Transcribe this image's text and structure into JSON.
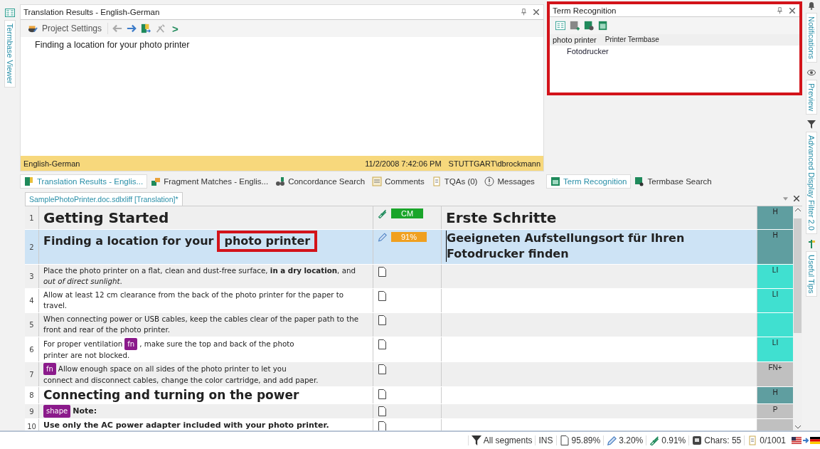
{
  "left_strip": {
    "tab": "Termbase Viewer"
  },
  "results_panel": {
    "title": "Translation Results - English-German",
    "toolbar": {
      "project_settings": "Project Settings",
      "next_symbol": ">"
    },
    "result": "Finding a location for your photo printer",
    "info_bar": {
      "language_pair": "English-German",
      "date": "11/2/2008 7:42:06 PM",
      "user": "STUTTGART\\dbrockmann"
    }
  },
  "term_panel": {
    "title": "Term Recognition",
    "highlighted": true,
    "terms": [
      {
        "source": "photo printer",
        "termbase": "Printer Termbase",
        "target": "Fotodrucker"
      }
    ]
  },
  "bottom_tabs": [
    {
      "label": "Translation Results - Englis...",
      "selected": true,
      "kind": "results"
    },
    {
      "label": "Fragment Matches - Englis...",
      "selected": false,
      "kind": "fragment"
    },
    {
      "label": "Concordance Search",
      "selected": false,
      "kind": "concordance"
    },
    {
      "label": "Comments",
      "selected": false,
      "kind": "comments"
    },
    {
      "label": "TQAs (0)",
      "selected": false,
      "kind": "tqa"
    },
    {
      "label": "Messages",
      "selected": false,
      "kind": "messages"
    }
  ],
  "term_tabs": [
    {
      "label": "Term Recognition",
      "selected": true,
      "kind": "term"
    },
    {
      "label": "Termbase Search",
      "selected": false,
      "kind": "search"
    }
  ],
  "document_tab": {
    "label": "SamplePhotoPrinter.doc.sdlxliff [Translation]*"
  },
  "segments": [
    {
      "number": "1",
      "kind": "heading1",
      "source": [
        {
          "kind": "text",
          "text": "Getting Started"
        }
      ],
      "status": {
        "kind": "confirmed",
        "match": "CM"
      },
      "target": "Erste Schritte",
      "selected": false,
      "structure": {
        "label": "H",
        "color": "#5f9ea0"
      }
    },
    {
      "number": "2",
      "kind": "heading2",
      "source": [
        {
          "kind": "text",
          "text": "Finding a location for your"
        },
        {
          "kind": "term",
          "text": "photo printer",
          "highlighted": true
        }
      ],
      "status": {
        "kind": "draft",
        "match": "91%"
      },
      "target": "Geeigneten Aufstellungsort für Ihren Fotodrucker finden",
      "selected": true,
      "structure": {
        "label": "H",
        "color": "#5f9ea0"
      }
    },
    {
      "number": "3",
      "kind": "body",
      "source": [
        {
          "kind": "text",
          "text": "Place the photo printer on a flat, clean and dust-free surface, **in a dry location**, and *out of direct sunlight*."
        }
      ],
      "status": {
        "kind": "untranslated"
      },
      "selected": false,
      "structure": {
        "label": "LI",
        "color": "#40e0d0"
      }
    },
    {
      "number": "4",
      "kind": "body",
      "source": [
        {
          "kind": "text",
          "text": "Allow at least 12 cm clearance from the back of the photo printer for the paper to travel."
        }
      ],
      "status": {
        "kind": "untranslated"
      },
      "selected": false,
      "structure": {
        "label": "LI",
        "color": "#40e0d0"
      }
    },
    {
      "number": "5",
      "kind": "body",
      "source": [
        {
          "kind": "text",
          "text": "When connecting power or USB cables, keep the cables clear of the paper path to the front and rear of the photo printer."
        }
      ],
      "status": {
        "kind": "untranslated"
      },
      "selected": false,
      "structure": {
        "color": "#40e0d0"
      }
    },
    {
      "number": "6",
      "kind": "body",
      "source": [
        {
          "kind": "text",
          "text": "For proper ventilation"
        },
        {
          "kind": "tag",
          "text": "fn"
        },
        {
          "kind": "text",
          "text": ", make sure the top and back of the photo"
        },
        {
          "kind": "text",
          "text": "printer are not blocked."
        }
      ],
      "status": {
        "kind": "untranslated"
      },
      "selected": false,
      "structure": {
        "label": "LI",
        "color": "#40e0d0"
      }
    },
    {
      "number": "7",
      "kind": "body",
      "source": [
        {
          "kind": "tag",
          "text": "fn"
        },
        {
          "kind": "text",
          "text": "Allow enough space on all sides of the photo printer to let you"
        },
        {
          "kind": "text",
          "text": "connect and disconnect cables, change the color cartridge, and add paper."
        }
      ],
      "status": {
        "kind": "untranslated"
      },
      "selected": false,
      "structure": {
        "label": "FN+",
        "color": "#c0c0c0"
      }
    },
    {
      "number": "8",
      "kind": "heading1b",
      "source": [
        {
          "kind": "text",
          "text": "Connecting and turning on the power"
        }
      ],
      "status": {
        "kind": "untranslated"
      },
      "selected": false,
      "structure": {
        "label": "H",
        "color": "#5f9ea0"
      }
    },
    {
      "number": "9",
      "kind": "bold",
      "source": [
        {
          "kind": "tag",
          "text": "shape"
        },
        {
          "kind": "text",
          "text": "Note:"
        }
      ],
      "status": {
        "kind": "untranslated"
      },
      "selected": false,
      "structure": {
        "label": "P",
        "color": "#c0c0c0"
      }
    },
    {
      "number": "10",
      "kind": "bold",
      "source": [
        {
          "kind": "text",
          "text": "Use only the AC power adapter included with your photo printer."
        }
      ],
      "status": {
        "kind": "untranslated"
      },
      "selected": false,
      "structure": {
        "color": "#c0c0c0"
      }
    }
  ],
  "side_tabs": [
    {
      "label": "Notifications",
      "kind": "bell"
    },
    {
      "label": "Preview",
      "kind": "eye"
    },
    {
      "label": "Advanced Display Filter 2.0",
      "kind": "filter"
    },
    {
      "label": "Useful Tips",
      "kind": "tips"
    }
  ],
  "status_bar": {
    "filter": "All segments",
    "mode": "INS",
    "untranslated": "95.89%",
    "draft": "3.20%",
    "translated": "0.91%",
    "chars": "Chars: 55",
    "tqa": "0/1001"
  }
}
